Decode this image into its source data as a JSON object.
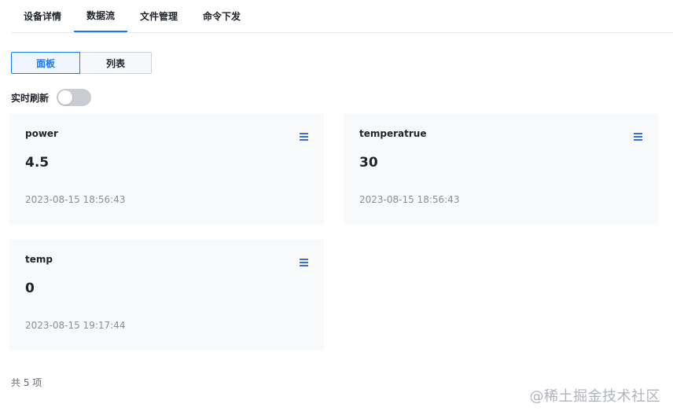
{
  "tabs": [
    {
      "label": "设备详情",
      "active": false
    },
    {
      "label": "数据流",
      "active": true
    },
    {
      "label": "文件管理",
      "active": false
    },
    {
      "label": "命令下发",
      "active": false
    }
  ],
  "view_switch": {
    "panel_label": "面板",
    "list_label": "列表",
    "selected": "面板"
  },
  "realtime": {
    "label": "实时刷新",
    "enabled": false
  },
  "cards": [
    {
      "name": "power",
      "value": "4.5",
      "time": "2023-08-15 18:56:43",
      "menu_icon": "menu-icon"
    },
    {
      "name": "temperatrue",
      "value": "30",
      "time": "2023-08-15 18:56:43",
      "menu_icon": "menu-icon"
    },
    {
      "name": "temp",
      "value": "0",
      "time": "2023-08-15 19:17:44",
      "menu_icon": "menu-icon"
    }
  ],
  "footer": {
    "total_label": "共 5 项"
  },
  "watermark": "@稀土掘金技术社区",
  "colors": {
    "accent": "#1677ff",
    "menu_icon": "#3a6fd8",
    "card_bg": "#f7f9fb"
  }
}
